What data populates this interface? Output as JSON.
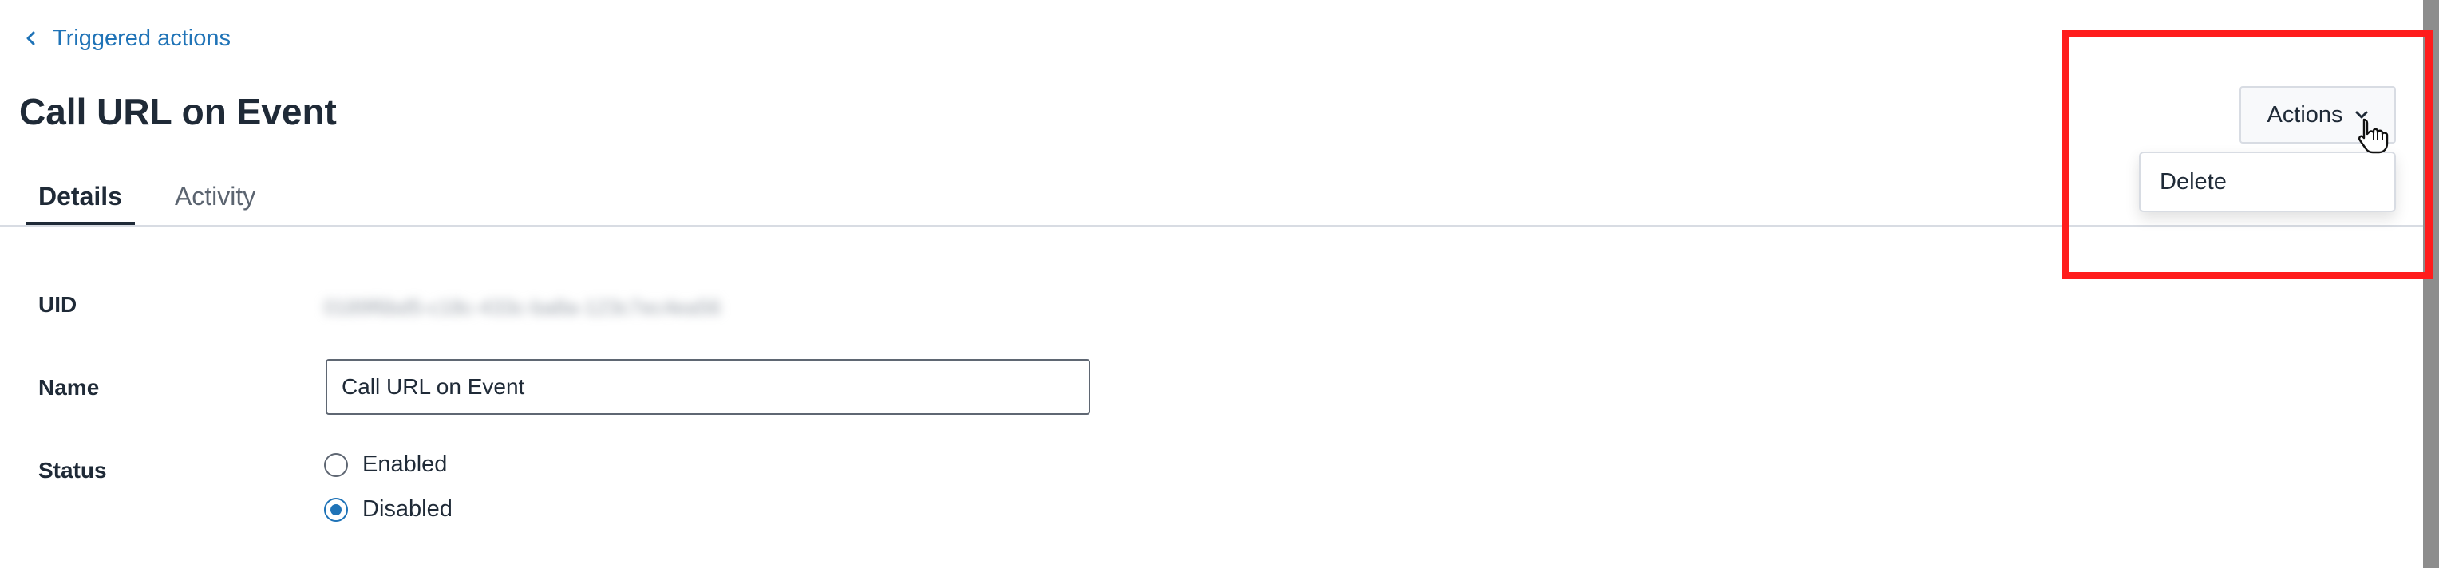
{
  "header": {
    "back_link_label": "Triggered actions",
    "title": "Call URL on Event",
    "actions_label": "Actions"
  },
  "tabs": [
    {
      "label": "Details",
      "active": true
    },
    {
      "label": "Activity",
      "active": false
    }
  ],
  "dropdown": {
    "items": [
      {
        "label": "Delete"
      }
    ]
  },
  "details": {
    "uid": {
      "label": "UID",
      "value": "0189f6bd5-c18c-433c-ba8a-123c7ec4ea56"
    },
    "name": {
      "label": "Name",
      "value": "Call URL on Event"
    },
    "status": {
      "label": "Status",
      "options": [
        {
          "label": "Enabled",
          "checked": false
        },
        {
          "label": "Disabled",
          "checked": true
        }
      ]
    }
  },
  "icons": {
    "back": "chevron-left-icon",
    "actions": "chevron-down-icon",
    "cursor": "pointer-hand-icon",
    "radio": "radio-icon"
  },
  "colors": {
    "accent": "#1f73b7",
    "text": "#1f2a37",
    "highlight": "#ff1c1c",
    "border": "#d8dce3"
  }
}
